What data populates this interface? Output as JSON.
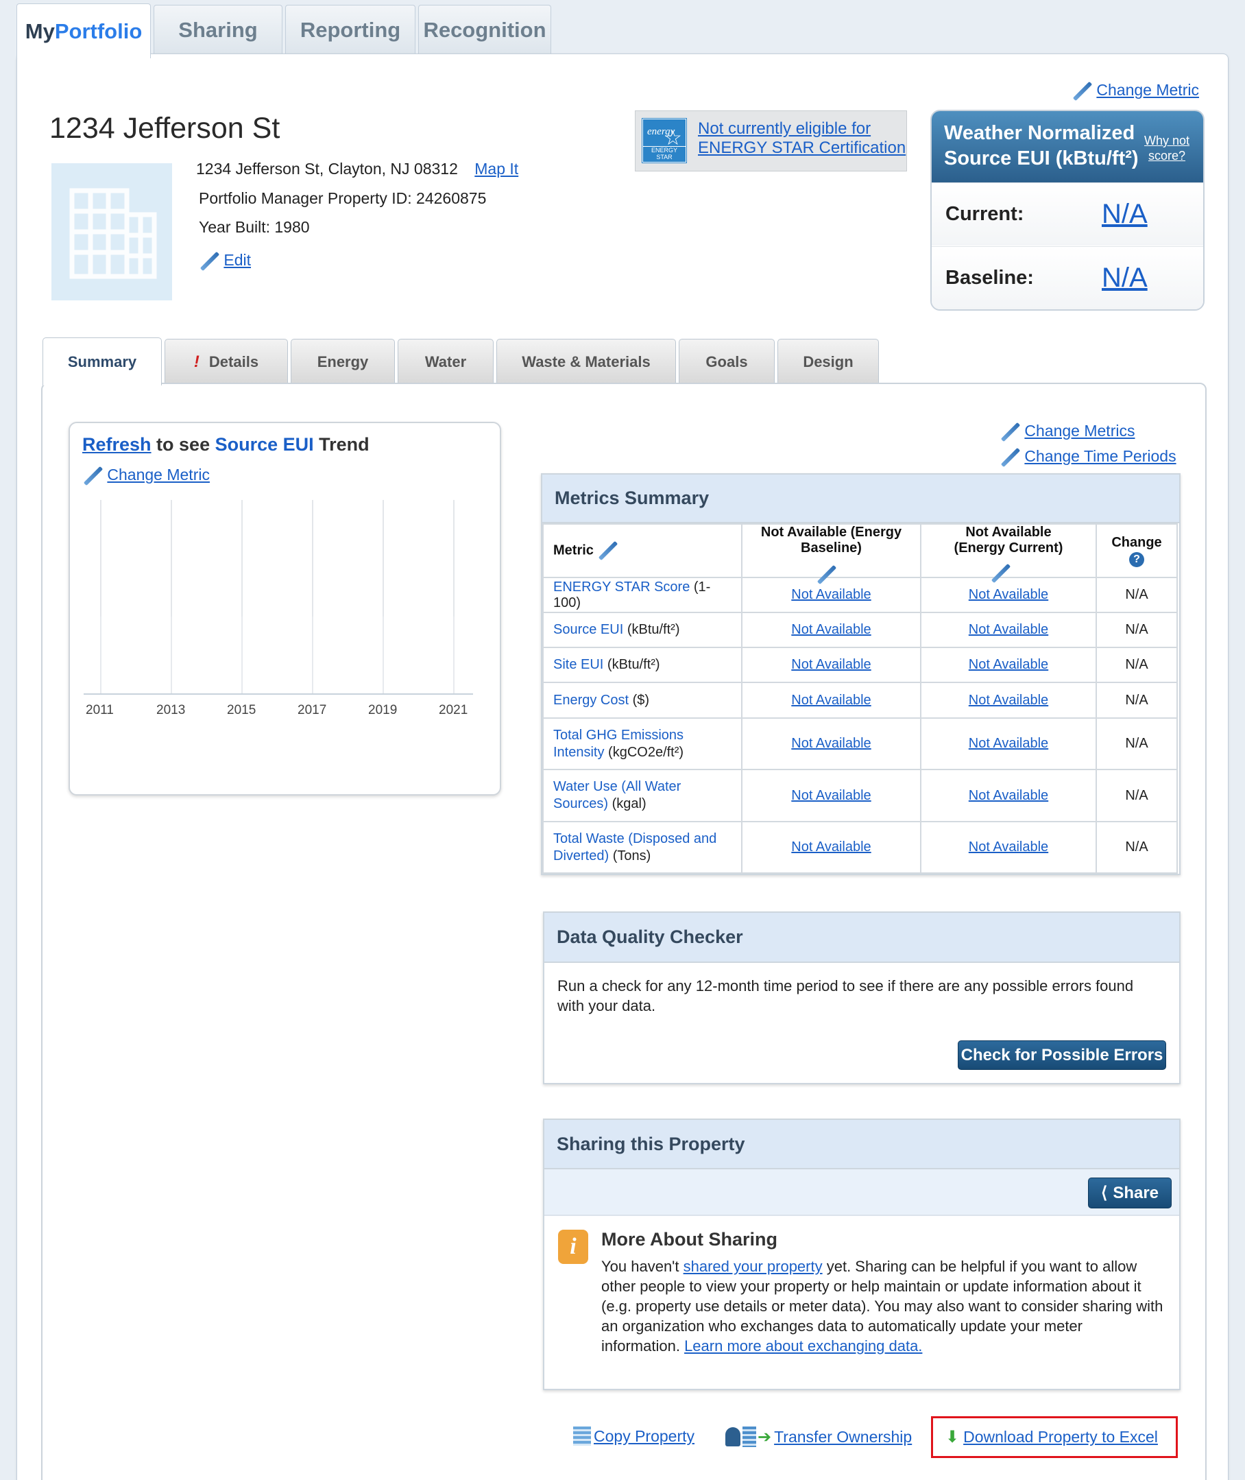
{
  "top_tabs": {
    "myportfolio_a": "My",
    "myportfolio_b": "Portfolio",
    "sharing": "Sharing",
    "reporting": "Reporting",
    "recognition": "Recognition"
  },
  "property": {
    "name": "1234 Jefferson St",
    "address": "1234 Jefferson St, Clayton, NJ 08312",
    "map_link": "Map It",
    "pm_id": "Portfolio Manager Property ID: 24260875",
    "year_built": "Year Built: 1980",
    "edit_link": "Edit"
  },
  "energy_star": {
    "logo_text": "ENERGY STAR",
    "logo_script": "energy",
    "status_line1": "Not currently eligible for",
    "status_line2": "ENERGY STAR Certification"
  },
  "eui": {
    "change_metric": "Change Metric",
    "title_line1": "Weather Normalized",
    "title_line2": "Source EUI (kBtu/ft²)",
    "why_line1": "Why not",
    "why_line2": "score?",
    "current_label": "Current:",
    "current_value": "N/A",
    "baseline_label": "Baseline:",
    "baseline_value": "N/A"
  },
  "sub_tabs": {
    "summary": "Summary",
    "details_alert": "!",
    "details": "Details",
    "energy": "Energy",
    "water": "Water",
    "waste": "Waste & Materials",
    "goals": "Goals",
    "design": "Design"
  },
  "trend": {
    "refresh": "Refresh",
    "to_see": " to see ",
    "metric": "Source EUI",
    "trend": " Trend",
    "change_metric": "Change Metric",
    "years": [
      "2011",
      "2013",
      "2015",
      "2017",
      "2019",
      "2021"
    ]
  },
  "metrics_links": {
    "change_metrics": "Change Metrics",
    "change_time": "Change Time Periods"
  },
  "metrics_summary": {
    "title": "Metrics Summary",
    "col_metric": "Metric",
    "col_baseline_1": "Not Available (Energy",
    "col_baseline_2": "Baseline)",
    "col_current_1": "Not Available",
    "col_current_2": "(Energy Current)",
    "col_change": "Change",
    "rows": [
      {
        "name1": "ENERGY STAR Score",
        "name2": "",
        "unit": " (1-100)",
        "baseline": "Not Available",
        "current": "Not Available",
        "change": "N/A"
      },
      {
        "name1": "Source EUI",
        "name2": "",
        "unit": " (kBtu/ft²)",
        "baseline": "Not Available",
        "current": "Not Available",
        "change": "N/A"
      },
      {
        "name1": "Site EUI",
        "name2": "",
        "unit": " (kBtu/ft²)",
        "baseline": "Not Available",
        "current": "Not Available",
        "change": "N/A"
      },
      {
        "name1": "Energy Cost",
        "name2": "",
        "unit": " ($)",
        "baseline": "Not Available",
        "current": "Not Available",
        "change": "N/A"
      },
      {
        "name1": "Total GHG Emissions",
        "name2": "Intensity",
        "unit": " (kgCO2e/ft²)",
        "baseline": "Not Available",
        "current": "Not Available",
        "change": "N/A"
      },
      {
        "name1": "Water Use (All Water",
        "name2": "Sources)",
        "unit": " (kgal)",
        "baseline": "Not Available",
        "current": "Not Available",
        "change": "N/A"
      },
      {
        "name1": "Total Waste (Disposed and",
        "name2": "Diverted)",
        "unit": " (Tons)",
        "baseline": "Not Available",
        "current": "Not Available",
        "change": "N/A"
      }
    ]
  },
  "dq": {
    "title": "Data Quality Checker",
    "text": "Run a check for any 12-month time period to see if there are any possible errors found with your data.",
    "button": "Check for Possible Errors"
  },
  "sharing": {
    "title": "Sharing this Property",
    "share_button": "Share",
    "more_title": "More About Sharing",
    "t1": "You haven't ",
    "link1": "shared your property",
    "t2": " yet. Sharing can be helpful if you want to allow other people to view your property or help maintain or update information about it (e.g. property use details or meter data). You may also want to consider sharing with an organization who exchanges data to automatically update your meter information. ",
    "link2": "Learn more about exchanging data."
  },
  "actions": {
    "copy": "Copy Property",
    "transfer": "Transfer Ownership",
    "download": "Download Property to Excel"
  }
}
